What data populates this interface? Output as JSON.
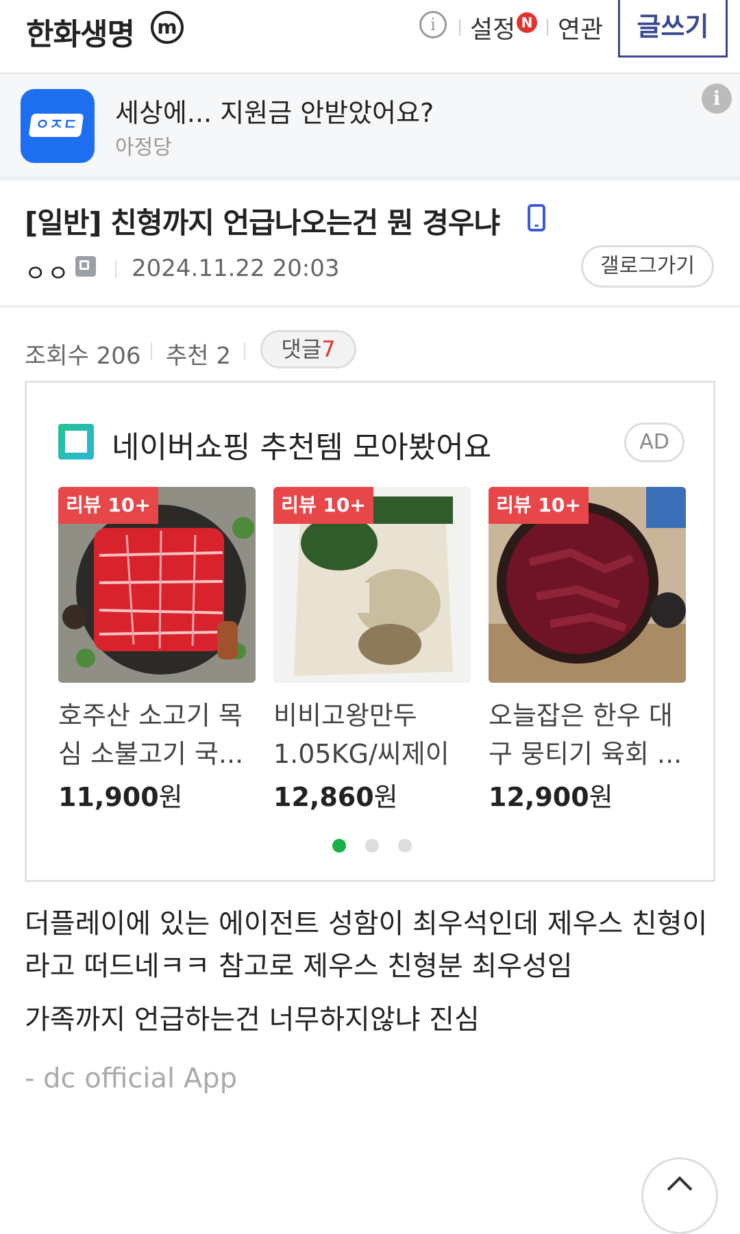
{
  "header": {
    "gallery_title": "한화생명",
    "minor_badge": "m",
    "settings_label": "설정",
    "new_badge": "N",
    "related_label": "연관",
    "write_label": "글쓰기"
  },
  "top_ad": {
    "logo_text": "ㅇㅈㄷ",
    "title": "세상에... 지원금 안받았어요?",
    "source": "아정당"
  },
  "post": {
    "title": "[일반] 친형까지 언급나오는건 뭔 경우냐",
    "author": "ㅇㅇ",
    "date": "2024.11.22 20:03",
    "gallery_button": "갤로그가기"
  },
  "stats": {
    "views": "조회수 206",
    "recommend": "추천 2",
    "comment_label": "댓글",
    "comment_count": "7"
  },
  "shopping_ad": {
    "title": "네이버쇼핑 추천템 모아봤어요",
    "ad_label": "AD",
    "products": [
      {
        "badge": "리뷰 10+",
        "name": "호주산 소고기 목심 소불고기 국...",
        "price": "11,900",
        "currency": "원"
      },
      {
        "badge": "리뷰 10+",
        "name": "비비고왕만두 1.05KG/씨제이",
        "price": "12,860",
        "currency": "원"
      },
      {
        "badge": "리뷰 10+",
        "name": "오늘잡은 한우 대구 뭉티기 육회 ...",
        "price": "12,900",
        "currency": "원"
      }
    ]
  },
  "body": {
    "line1": "더플레이에 있는 에이전트 성함이 최우석인데 제우스 친형이",
    "line2": "라고 떠드네ㅋㅋ 참고로 제우스 친형분 최우성임",
    "line3": "가족까지 언급하는건 너무하지않냐 진심",
    "signature": "- dc official App"
  }
}
